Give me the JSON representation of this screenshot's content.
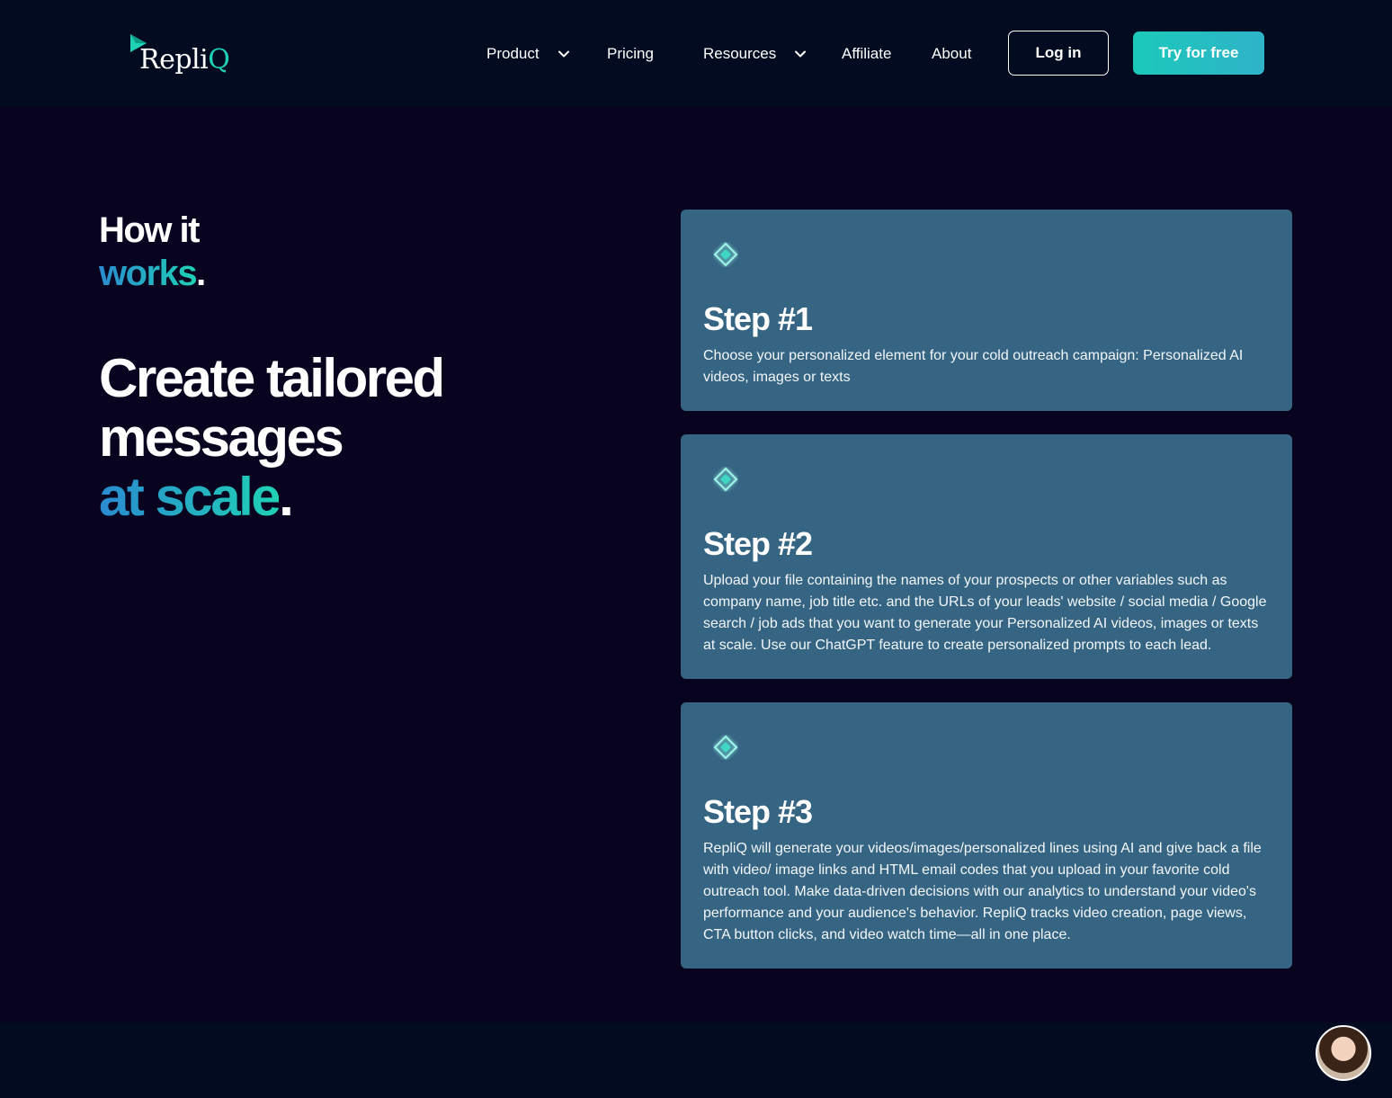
{
  "nav": {
    "logo": {
      "brand_main": "Repli",
      "brand_accent": "Q"
    },
    "items": [
      {
        "label": "Product",
        "has_dropdown": true
      },
      {
        "label": "Pricing",
        "has_dropdown": false
      },
      {
        "label": "Resources",
        "has_dropdown": true
      },
      {
        "label": "Affiliate",
        "has_dropdown": false
      },
      {
        "label": "About",
        "has_dropdown": false
      }
    ],
    "login_label": "Log in",
    "try_label": "Try for free"
  },
  "section": {
    "kicker_line1": "How it",
    "kicker_line2_accent": "works",
    "kicker_dot": ".",
    "headline_line1": "Create tailored",
    "headline_line2": "messages",
    "headline_line3_accent": "at scale",
    "headline_dot": "."
  },
  "steps": [
    {
      "title": "Step #1",
      "text": "Choose your personalized element for your cold outreach campaign: Personalized AI videos, images or texts"
    },
    {
      "title": "Step #2",
      "text": "Upload your file containing the names of your prospects or other variables such as company name, job title etc. and the URLs of your leads' website / social media / Google search / job ads that you want to generate your Personalized AI videos, images or texts at scale. Use our ChatGPT feature to create personalized prompts to each lead."
    },
    {
      "title": "Step #3",
      "text": "RepliQ will generate your videos/images/personalized lines using AI and give back a file with video/ image links and HTML email codes that you upload in your favorite cold outreach tool. Make data-driven decisions with our analytics to understand your video's performance and your audience's behavior. RepliQ tracks video creation, page views, CTA button clicks, and video watch time—all in one place."
    }
  ],
  "icons": {
    "step_icon": "diamond-icon",
    "dropdown_icon": "chevron-down-icon",
    "chat_avatar": "support-avatar"
  },
  "colors": {
    "background": "#08041f",
    "nav_background": "#020b1f",
    "card": "#356582",
    "accent_teal": "#1fd1b5",
    "accent_blue": "#2a8bd0"
  }
}
